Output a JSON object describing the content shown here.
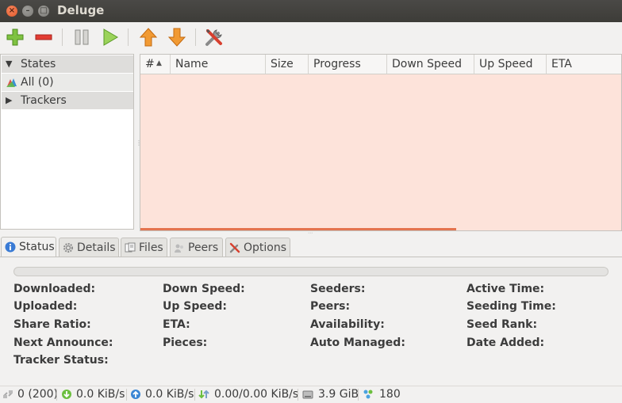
{
  "window": {
    "title": "Deluge"
  },
  "toolbar": {
    "buttons": [
      {
        "name": "add-torrent",
        "icon": "plus-icon"
      },
      {
        "name": "remove-torrent",
        "icon": "minus-icon"
      },
      {
        "name": "pause",
        "icon": "pause-icon"
      },
      {
        "name": "resume",
        "icon": "play-icon"
      },
      {
        "name": "queue-up",
        "icon": "arrow-up-icon"
      },
      {
        "name": "queue-down",
        "icon": "arrow-down-icon"
      },
      {
        "name": "preferences",
        "icon": "tools-icon"
      }
    ]
  },
  "sidebar": {
    "states_label": "States",
    "all_label": "All (0)",
    "trackers_label": "Trackers"
  },
  "list": {
    "columns": [
      "#",
      "Name",
      "Size",
      "Progress",
      "Down Speed",
      "Up Speed",
      "ETA"
    ],
    "rows": []
  },
  "tabs": [
    {
      "label": "Status",
      "icon": "info-icon",
      "active": true
    },
    {
      "label": "Details",
      "icon": "gear-icon",
      "active": false
    },
    {
      "label": "Files",
      "icon": "files-icon",
      "active": false
    },
    {
      "label": "Peers",
      "icon": "peers-icon",
      "active": false
    },
    {
      "label": "Options",
      "icon": "tools-icon",
      "active": false
    }
  ],
  "status": {
    "col1": [
      "Downloaded:",
      "Uploaded:",
      "Share Ratio:",
      "Next Announce:",
      "Tracker Status:"
    ],
    "col2": [
      "Down Speed:",
      "Up Speed:",
      "ETA:",
      "Pieces:"
    ],
    "col3": [
      "Seeders:",
      "Peers:",
      "Availability:",
      "Auto Managed:"
    ],
    "col4": [
      "Active Time:",
      "Seeding Time:",
      "Seed Rank:",
      "Date Added:"
    ]
  },
  "statusbar": {
    "connections": "0 (200)",
    "download_speed": "0.0 KiB/s",
    "upload_speed": "0.0 KiB/s",
    "protocol_traffic": "0.00/0.00 KiB/s",
    "free_space": "3.9 GiB",
    "dht_nodes": "180"
  },
  "colors": {
    "list_bg": "#fde3da",
    "accent": "#e4744f"
  }
}
